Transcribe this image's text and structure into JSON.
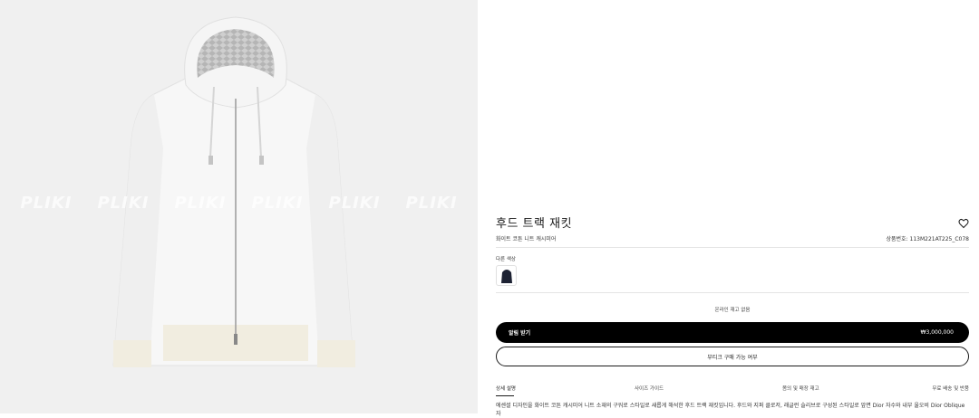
{
  "watermark": [
    "PLIKI",
    "PLIKI",
    "PLIKI",
    "PLIKI",
    "PLIKI",
    "PLIKI"
  ],
  "product": {
    "title": "후드 트랙 재킷",
    "subtitle": "화이트 코튼 니트 캐시미어",
    "reference": "상품번호: 113M221AT225_C078",
    "colors_label": "다른 색상",
    "stock_status": "온라인 재고 없음",
    "notify_label": "알림 받기",
    "price": "₩3,000,000",
    "boutique_label": "부티크 구매 가능 여부"
  },
  "tabs": [
    {
      "label": "상세 설명",
      "active": true
    },
    {
      "label": "사이즈 가이드",
      "active": false
    },
    {
      "label": "몸의 및 매장 재고",
      "active": false
    },
    {
      "label": "무료 배송 및 반품",
      "active": false
    }
  ],
  "description": "에센셜 디자인을 화이트 코튼 캐시미어 니트 소재의 구워로 스타일로 새롭게 해석한 후드 트랙 재킷입니다. 후드와 지퍼 클로저, 래글런 슬리브로 구성된 스타일로 앞면 Dior 자수와 내부 울오비 Dior Oblique 자",
  "colors": {
    "accent": "#000000",
    "border": "#e5e5e5",
    "image_bg": "#f0f0f0"
  }
}
